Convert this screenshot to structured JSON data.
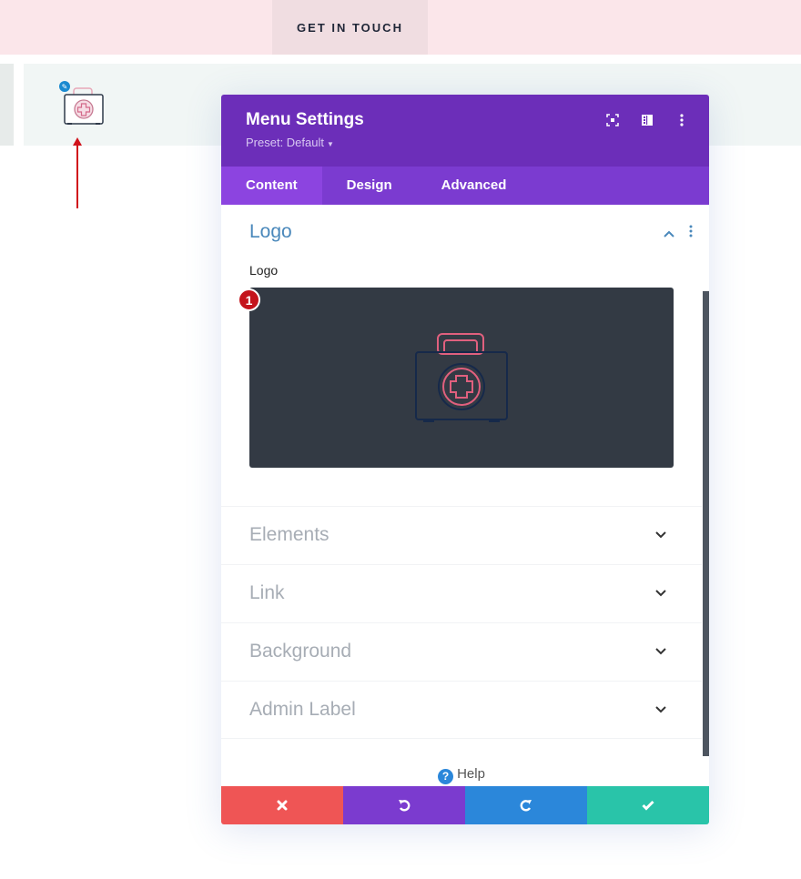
{
  "topbar": {
    "cta_label": "GET IN TOUCH"
  },
  "modal": {
    "title": "Menu Settings",
    "preset": "Preset: Default",
    "header_icons": [
      "expand-icon",
      "split-view-icon",
      "more-options-icon"
    ],
    "tabs": [
      {
        "label": "Content",
        "active": true
      },
      {
        "label": "Design",
        "active": false
      },
      {
        "label": "Advanced",
        "active": false
      }
    ],
    "open_section": {
      "title": "Logo",
      "field_label": "Logo",
      "badge_number": "1"
    },
    "sections": [
      {
        "label": "Elements"
      },
      {
        "label": "Link"
      },
      {
        "label": "Background"
      },
      {
        "label": "Admin Label"
      }
    ],
    "help_label": "Help",
    "footer_buttons": [
      {
        "name": "discard",
        "icon": "close-icon",
        "color": "#ef5555"
      },
      {
        "name": "undo",
        "icon": "undo-icon",
        "color": "#7b3bcf"
      },
      {
        "name": "redo",
        "icon": "redo-icon",
        "color": "#2b87da"
      },
      {
        "name": "save",
        "icon": "check-icon",
        "color": "#29c4a9"
      }
    ]
  },
  "colors": {
    "header_purple": "#6c2eb9",
    "tab_purple": "#7b3bd0",
    "section_blue": "#4a88bb",
    "badge_red": "#c4141c",
    "logo_pink": "#e0607e",
    "logo_navy": "#1d3557"
  }
}
